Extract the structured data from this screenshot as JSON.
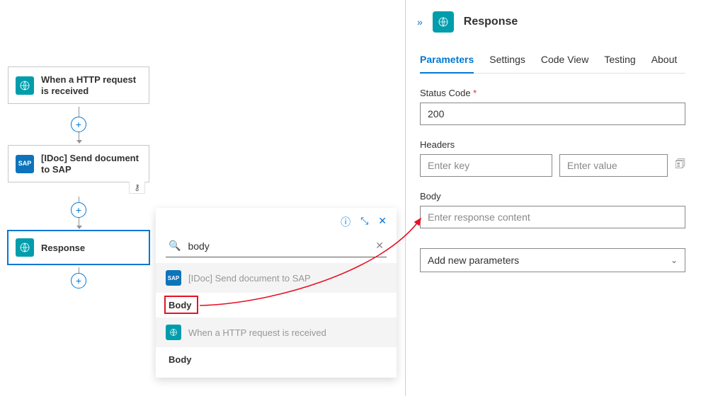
{
  "flow": {
    "step1_label": "When a HTTP request is received",
    "step2_label": "[IDoc] Send document to SAP",
    "step3_label": "Response",
    "sap_badge": "SAP"
  },
  "popup": {
    "search_value": "body",
    "group1_label": "[IDoc] Send document to SAP",
    "item1_label": "Body",
    "group2_label": "When a HTTP request is received",
    "item2_label": "Body"
  },
  "panel": {
    "title": "Response",
    "tabs": {
      "parameters": "Parameters",
      "settings": "Settings",
      "codeview": "Code View",
      "testing": "Testing",
      "about": "About"
    },
    "status_label": "Status Code",
    "status_value": "200",
    "headers_label": "Headers",
    "headers_key_placeholder": "Enter key",
    "headers_val_placeholder": "Enter value",
    "body_label": "Body",
    "body_placeholder": "Enter response content",
    "param_select_label": "Add new parameters"
  }
}
